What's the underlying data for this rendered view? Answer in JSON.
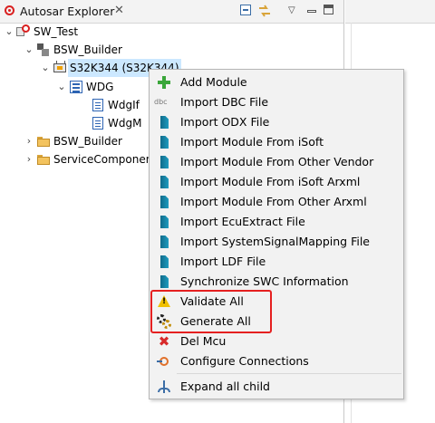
{
  "view": {
    "title": "Autosar Explorer",
    "close_glyph": "✕",
    "header_icons": [
      "collapse-all-icon",
      "link-with-editor-icon",
      "view-menu-icon",
      "minimize-icon",
      "maximize-icon"
    ]
  },
  "tree": {
    "items": [
      {
        "label": "SW_Test",
        "icon": "project-icon",
        "expanded": true
      },
      {
        "label": "BSW_Builder",
        "icon": "builder-icon",
        "expanded": true
      },
      {
        "label": "S32K344 (S32K344)",
        "icon": "mcu-icon",
        "expanded": true,
        "selected": true
      },
      {
        "label": "WDG",
        "icon": "module-list-icon",
        "expanded": true
      },
      {
        "label": "WdgIf",
        "icon": "document-icon"
      },
      {
        "label": "WdgM",
        "icon": "document-icon"
      },
      {
        "label": "BSW_Builder",
        "icon": "folder-icon",
        "expanded": false
      },
      {
        "label": "ServiceComponen",
        "icon": "folder-icon",
        "expanded": false
      }
    ]
  },
  "context_menu": {
    "items": [
      {
        "label": "Add Module",
        "icon": "plus-icon"
      },
      {
        "label": "Import DBC File",
        "icon": "dbc-icon",
        "icon_text": "dbc"
      },
      {
        "label": "Import ODX File",
        "icon": "import-icon"
      },
      {
        "label": "Import Module From iSoft",
        "icon": "import-icon"
      },
      {
        "label": "Import Module From Other Vendor",
        "icon": "import-icon"
      },
      {
        "label": "Import Module From iSoft Arxml",
        "icon": "import-icon"
      },
      {
        "label": "Import Module From Other Arxml",
        "icon": "import-icon"
      },
      {
        "label": "Import EcuExtract File",
        "icon": "import-icon"
      },
      {
        "label": "Import SystemSignalMapping File",
        "icon": "import-icon"
      },
      {
        "label": "Import LDF File",
        "icon": "import-icon"
      },
      {
        "label": "Synchronize SWC Information",
        "icon": "import-icon"
      },
      {
        "label": "Validate All",
        "icon": "warning-icon"
      },
      {
        "label": "Generate All",
        "icon": "gear-icon"
      },
      {
        "label": "Del Mcu",
        "icon": "delete-icon",
        "icon_text": "✖"
      },
      {
        "label": "Configure Connections",
        "icon": "connect-icon"
      },
      {
        "label": "Expand all child",
        "icon": "expand-icon"
      }
    ],
    "highlighted_items": [
      "Validate All",
      "Generate All"
    ],
    "highlight_color": "#e52020"
  },
  "colors": {
    "selection": "#cce8ff",
    "menu_background": "#f2f2f2"
  }
}
